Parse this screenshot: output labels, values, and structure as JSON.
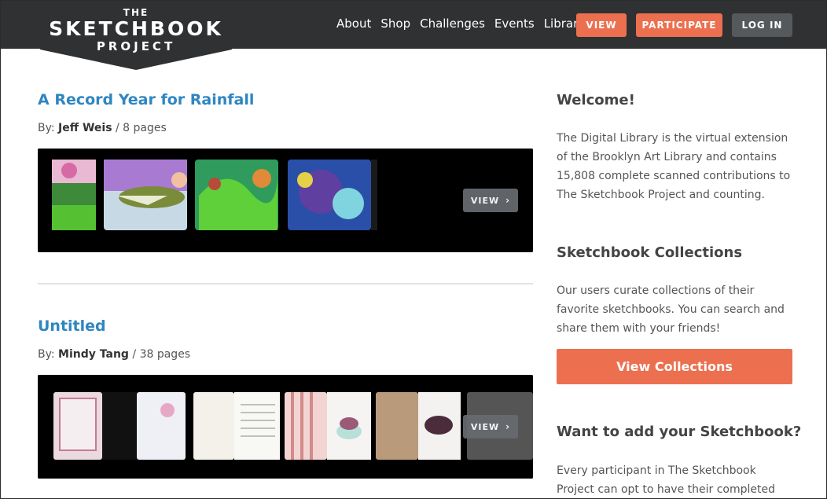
{
  "header": {
    "logo": {
      "line1": "THE",
      "line2": "SKETCHBOOK",
      "line3": "PROJECT"
    },
    "nav": [
      "About",
      "Shop",
      "Challenges",
      "Events",
      "Libraries"
    ],
    "buttons": {
      "view": "VIEW",
      "participate": "PARTICIPATE",
      "login": "LOG IN"
    }
  },
  "posts": [
    {
      "title": "A Record Year for Rainfall",
      "by_label": "By:",
      "author": "Jeff Weis",
      "pages": "/ 8 pages",
      "view_label": "VIEW"
    },
    {
      "title": "Untitled",
      "by_label": "By:",
      "author": "Mindy Tang",
      "pages": "/ 38 pages",
      "view_label": "VIEW"
    }
  ],
  "sidebar": {
    "welcome_heading": "Welcome!",
    "welcome_text": "The Digital Library is the virtual extension of the Brooklyn Art Library and contains 15,808 complete scanned contributions to The Sketchbook Project and counting.",
    "collections_heading": "Sketchbook Collections",
    "collections_text": "Our users curate collections of their favorite sketchbooks. You can search and share them with your friends!",
    "collections_button": "View Collections",
    "add_heading": "Want to add your Sketchbook?",
    "add_text": "Every participant in The Sketchbook Project can opt to have their completed work professionally"
  },
  "colors": {
    "header_bg": "#2f3133",
    "accent": "#ec7050",
    "link": "#2e86c1",
    "login_bg": "#55595c"
  }
}
